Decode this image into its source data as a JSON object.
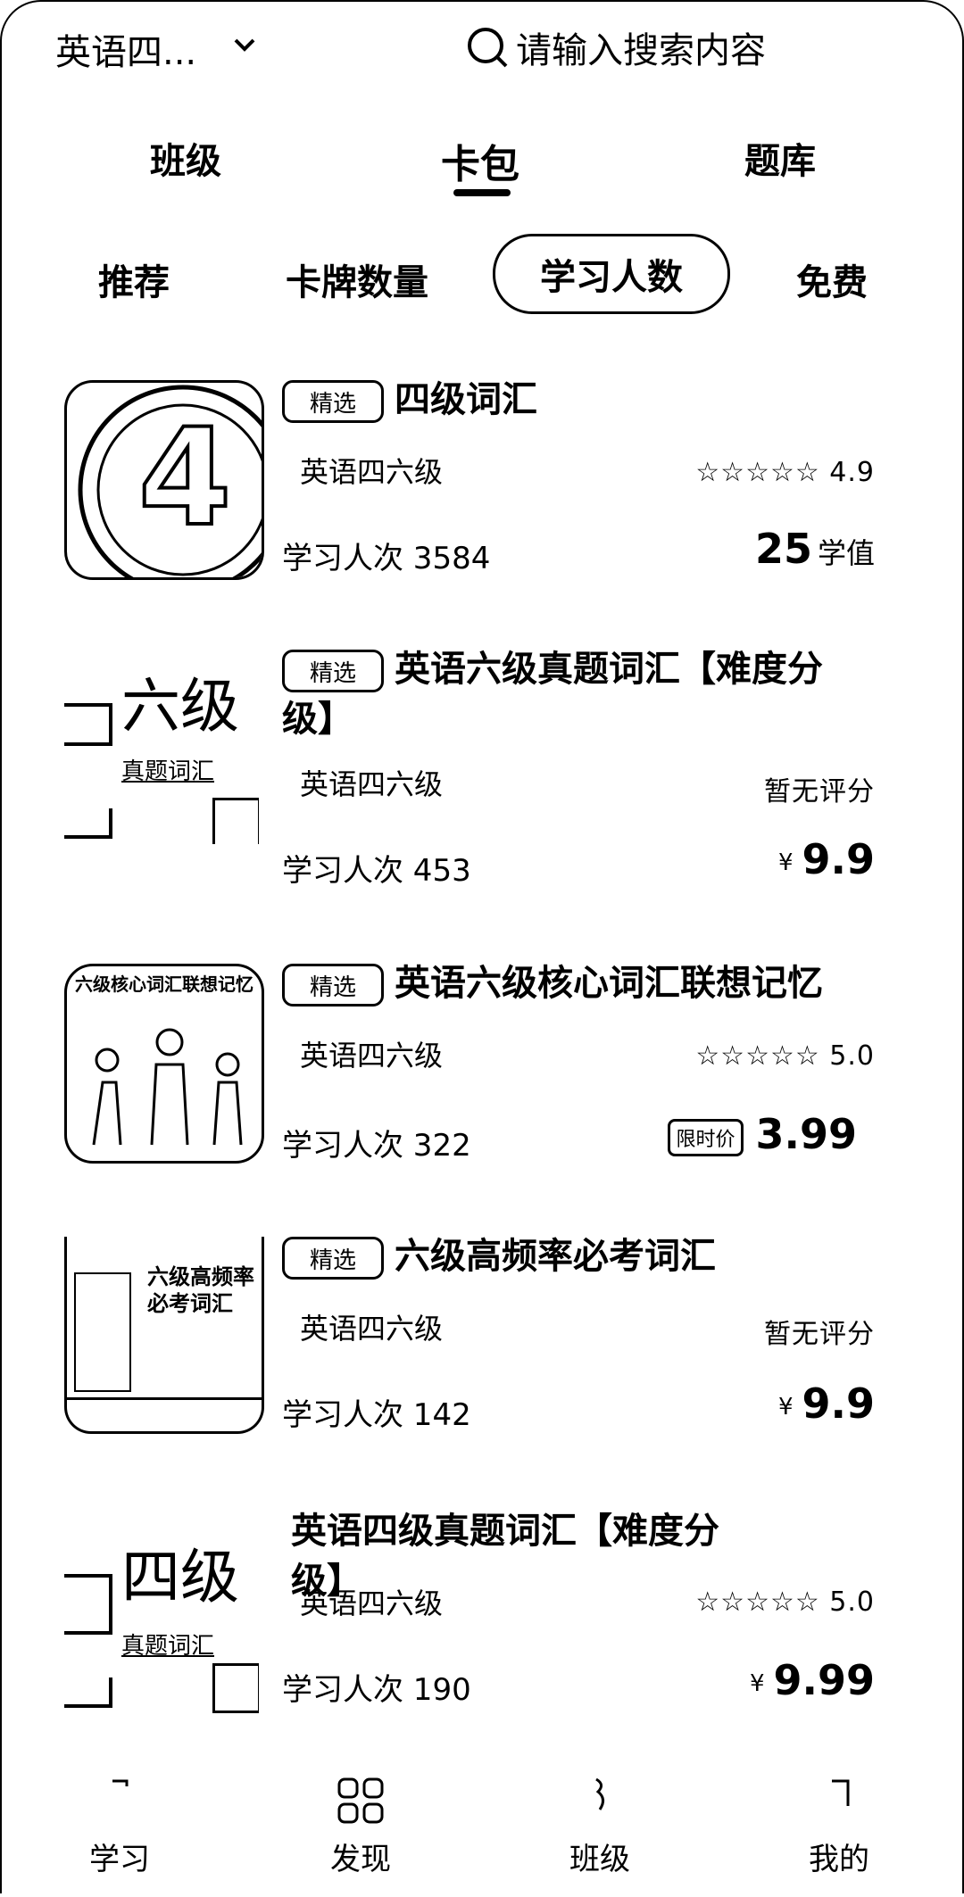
{
  "header": {
    "category": "英语四...",
    "search_placeholder": "请输入搜索内容"
  },
  "tabs": [
    {
      "label": "班级"
    },
    {
      "label": "卡包",
      "active": true
    },
    {
      "label": "题库"
    }
  ],
  "filters": [
    {
      "label": "推荐"
    },
    {
      "label": "卡牌数量"
    },
    {
      "label": "学习人数",
      "active": true
    },
    {
      "label": "免费"
    }
  ],
  "items": [
    {
      "badge": "精选",
      "title": "四级词汇",
      "category": "英语四六级",
      "rating": "☆☆☆☆☆ 4.9",
      "learners": "学习人次 3584",
      "price": "25",
      "price_unit": "学值",
      "thumb_text": "4"
    },
    {
      "badge": "精选",
      "title": "英语六级真题词汇【难度分级】",
      "category": "英语四六级",
      "rating": "暂无评分",
      "learners": "学习人次 453",
      "currency": "¥",
      "price": "9.9",
      "thumb_text": "六级",
      "thumb_sub": "真题词汇"
    },
    {
      "badge": "精选",
      "title": "英语六级核心词汇联想记忆",
      "category": "英语四六级",
      "rating": "☆☆☆☆☆ 5.0",
      "learners": "学习人次 322",
      "price_tag": "限时价",
      "price": "3.99",
      "thumb_text": "六级核心词汇联想记忆"
    },
    {
      "badge": "精选",
      "title": "六级高频率必考词汇",
      "category": "英语四六级",
      "rating": "暂无评分",
      "learners": "学习人次 142",
      "currency": "¥",
      "price": "9.9",
      "thumb_text": "六级高频率必考词汇"
    },
    {
      "title": "英语四级真题词汇【难度分级】",
      "category": "英语四六级",
      "rating": "☆☆☆☆☆ 5.0",
      "learners": "学习人次 190",
      "currency": "¥",
      "price": "9.99",
      "thumb_text": "四级",
      "thumb_sub": "真题词汇"
    }
  ],
  "nav": [
    {
      "label": "学习"
    },
    {
      "label": "发现"
    },
    {
      "label": "班级"
    },
    {
      "label": "我的"
    }
  ]
}
